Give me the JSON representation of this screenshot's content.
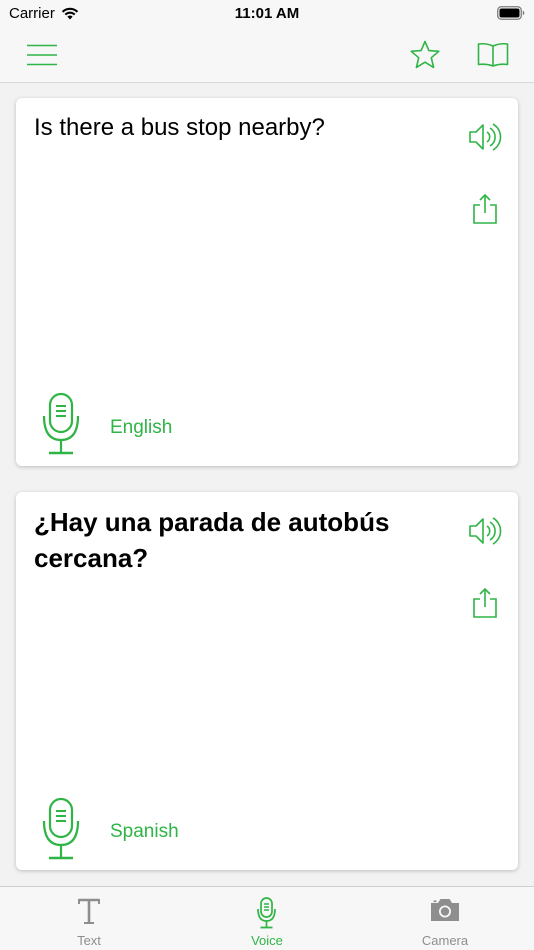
{
  "status_bar": {
    "carrier": "Carrier",
    "time": "11:01 AM"
  },
  "nav": {
    "menu_icon": "hamburger-icon",
    "favorite_icon": "star-icon",
    "phrasebook_icon": "book-icon"
  },
  "source_card": {
    "text": "Is there a bus stop nearby?",
    "language": "English"
  },
  "target_card": {
    "text": "¿Hay una parada de autobús cercana?",
    "language": "Spanish"
  },
  "tabs": [
    {
      "label": "Text",
      "icon": "text-icon",
      "active": false
    },
    {
      "label": "Voice",
      "icon": "microphone-icon",
      "active": true
    },
    {
      "label": "Camera",
      "icon": "camera-icon",
      "active": false
    }
  ],
  "colors": {
    "accent": "#2fb446",
    "inactive": "#8e8e8e",
    "background": "#f2f2f2",
    "card": "#ffffff"
  }
}
